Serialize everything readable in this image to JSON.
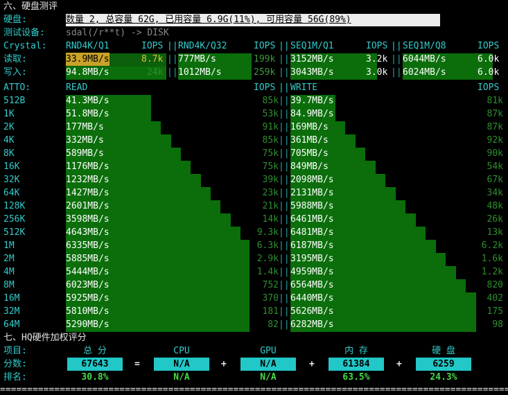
{
  "section6": {
    "title": "六、硬盘测评",
    "disk_label": "硬盘:",
    "disk_summary": "数量 2, 总容量 62G, 已用容量 6.9G(11%), 可用容量 56G(89%)",
    "device_label": "测试设备:",
    "device_value": "sdal(/r**t) -> DISK"
  },
  "crystal": {
    "label": "Crystal:",
    "headers": [
      "RND4K/Q1",
      "IOPS",
      "RND4K/Q32",
      "IOPS",
      "SEQ1M/Q1",
      "IOPS",
      "SEQ1M/Q8",
      "IOPS"
    ],
    "read": {
      "label": "读取:",
      "values": [
        "33.9MB/s",
        "8.7k",
        "777MB/s",
        "199k",
        "3152MB/s",
        "3.2k",
        "6044MB/s",
        "6.0k"
      ]
    },
    "write": {
      "label": "写入:",
      "values": [
        "94.8MB/s",
        "24k",
        "1012MB/s",
        "259k",
        "3043MB/s",
        "3.0k",
        "6024MB/s",
        "6.0k"
      ]
    }
  },
  "atto": {
    "label": "ATTO:",
    "read_header": "READ",
    "write_header": "WRITE",
    "iops_header": "IOPS",
    "rows": [
      {
        "size": "512B",
        "read": "41.3MB/s",
        "read_iops": "85k",
        "write": "39.7MB/s",
        "write_iops": "81k",
        "read_fill": 0.016,
        "write_fill": 0.016
      },
      {
        "size": "1K",
        "read": "51.8MB/s",
        "read_iops": "53k",
        "write": "84.9MB/s",
        "write_iops": "87k",
        "read_fill": 0.016,
        "write_fill": 0.016
      },
      {
        "size": "2K",
        "read": "177MB/s",
        "read_iops": "91k",
        "write": "169MB/s",
        "write_iops": "87k",
        "read_fill": 0.063,
        "write_fill": 0.063
      },
      {
        "size": "4K",
        "read": "332MB/s",
        "read_iops": "85k",
        "write": "361MB/s",
        "write_iops": "92k",
        "read_fill": 0.11,
        "write_fill": 0.11
      },
      {
        "size": "8K",
        "read": "589MB/s",
        "read_iops": "75k",
        "write": "705MB/s",
        "write_iops": "90k",
        "read_fill": 0.157,
        "write_fill": 0.157
      },
      {
        "size": "16K",
        "read": "1176MB/s",
        "read_iops": "75k",
        "write": "849MB/s",
        "write_iops": "54k",
        "read_fill": 0.204,
        "write_fill": 0.204
      },
      {
        "size": "32K",
        "read": "1232MB/s",
        "read_iops": "39k",
        "write": "2098MB/s",
        "write_iops": "67k",
        "read_fill": 0.251,
        "write_fill": 0.251
      },
      {
        "size": "64K",
        "read": "1427MB/s",
        "read_iops": "23k",
        "write": "2131MB/s",
        "write_iops": "34k",
        "read_fill": 0.298,
        "write_fill": 0.298
      },
      {
        "size": "128K",
        "read": "2601MB/s",
        "read_iops": "21k",
        "write": "5988MB/s",
        "write_iops": "48k",
        "read_fill": 0.345,
        "write_fill": 0.345
      },
      {
        "size": "256K",
        "read": "3598MB/s",
        "read_iops": "14k",
        "write": "6461MB/s",
        "write_iops": "26k",
        "read_fill": 0.392,
        "write_fill": 0.392
      },
      {
        "size": "512K",
        "read": "4643MB/s",
        "read_iops": "9.3k",
        "write": "6481MB/s",
        "write_iops": "13k",
        "read_fill": 0.439,
        "write_fill": 0.439
      },
      {
        "size": "1M",
        "read": "6335MB/s",
        "read_iops": "6.3k",
        "write": "6187MB/s",
        "write_iops": "6.2k",
        "read_fill": 0.486,
        "write_fill": 0.486
      },
      {
        "size": "2M",
        "read": "5885MB/s",
        "read_iops": "2.9k",
        "write": "3195MB/s",
        "write_iops": "1.6k",
        "read_fill": 0.533,
        "write_fill": 0.533
      },
      {
        "size": "4M",
        "read": "5444MB/s",
        "read_iops": "1.4k",
        "write": "4959MB/s",
        "write_iops": "1.2k",
        "read_fill": 0.58,
        "write_fill": 0.58
      },
      {
        "size": "8M",
        "read": "6023MB/s",
        "read_iops": "752",
        "write": "6564MB/s",
        "write_iops": "820",
        "read_fill": 0.627,
        "write_fill": 0.627
      },
      {
        "size": "16M",
        "read": "5925MB/s",
        "read_iops": "370",
        "write": "6440MB/s",
        "write_iops": "402",
        "read_fill": 0.674,
        "write_fill": 0.674
      },
      {
        "size": "32M",
        "read": "5810MB/s",
        "read_iops": "181",
        "write": "5626MB/s",
        "write_iops": "175",
        "read_fill": 0.721,
        "write_fill": 0.721
      },
      {
        "size": "64M",
        "read": "5290MB/s",
        "read_iops": "82",
        "write": "6282MB/s",
        "write_iops": "98",
        "read_fill": 0.768,
        "write_fill": 0.768
      }
    ]
  },
  "section7": {
    "title": "七、HQ硬件加权评分",
    "item_label": "项目:",
    "score_label": "分数:",
    "rank_label": "排名:",
    "columns": [
      {
        "name": "总 分",
        "score": "67643",
        "rank": "30.8%"
      },
      {
        "name": "CPU",
        "score": "N/A",
        "rank": "N/A"
      },
      {
        "name": "GPU",
        "score": "N/A",
        "rank": "N/A"
      },
      {
        "name": "内 存",
        "score": "61384",
        "rank": "63.5%"
      },
      {
        "name": "硬 盘",
        "score": "6259",
        "rank": "24.3%"
      }
    ],
    "operators": [
      "=",
      "+",
      "+",
      "+"
    ]
  },
  "separator": "================================================================================================",
  "colors": {
    "bar_green": "#0b6e0b",
    "cyan_box": "#22c7c7",
    "rank_green": "#44dd44",
    "highlight_yellow": "#c9a227"
  }
}
